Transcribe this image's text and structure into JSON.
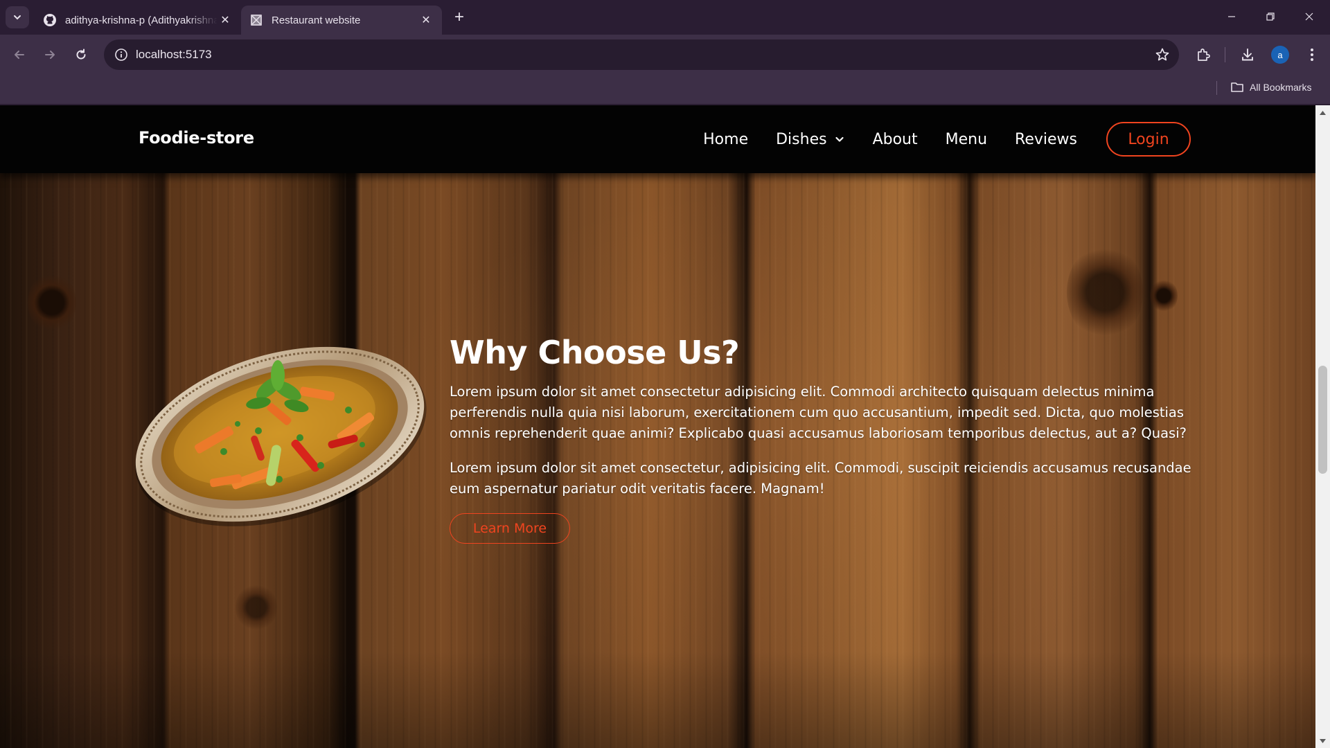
{
  "browser": {
    "tabs": [
      {
        "title": "adithya-krishna-p (Adithyakrishna",
        "icon": "github-icon",
        "active": false
      },
      {
        "title": "Restaurant website",
        "icon": "page-icon",
        "active": true
      }
    ],
    "address": "localhost:5173",
    "bookmarks_label": "All Bookmarks",
    "profile_initial": "a"
  },
  "site": {
    "brand": "Foodie-store",
    "nav": {
      "home": "Home",
      "dishes": "Dishes",
      "about": "About",
      "menu": "Menu",
      "reviews": "Reviews",
      "login": "Login"
    },
    "section": {
      "heading": "Why Choose Us?",
      "paragraph1": "Lorem ipsum dolor sit amet consectetur adipisicing elit. Commodi architecto quisquam delectus minima perferendis nulla quia nisi laborum, exercitationem cum quo accusantium, impedit sed. Dicta, quo molestias omnis reprehenderit quae animi? Explicabo quasi accusamus laboriosam temporibus delectus, aut a? Quasi?",
      "paragraph2": "Lorem ipsum dolor sit amet consectetur, adipisicing elit. Commodi, suscipit reiciendis accusamus recusandae eum aspernatur pariatur odit veritatis facere. Magnam!",
      "button": "Learn More"
    }
  },
  "colors": {
    "accent": "#f0441f",
    "nav_bg": "#030303",
    "chrome_bg": "#3d2f47"
  }
}
